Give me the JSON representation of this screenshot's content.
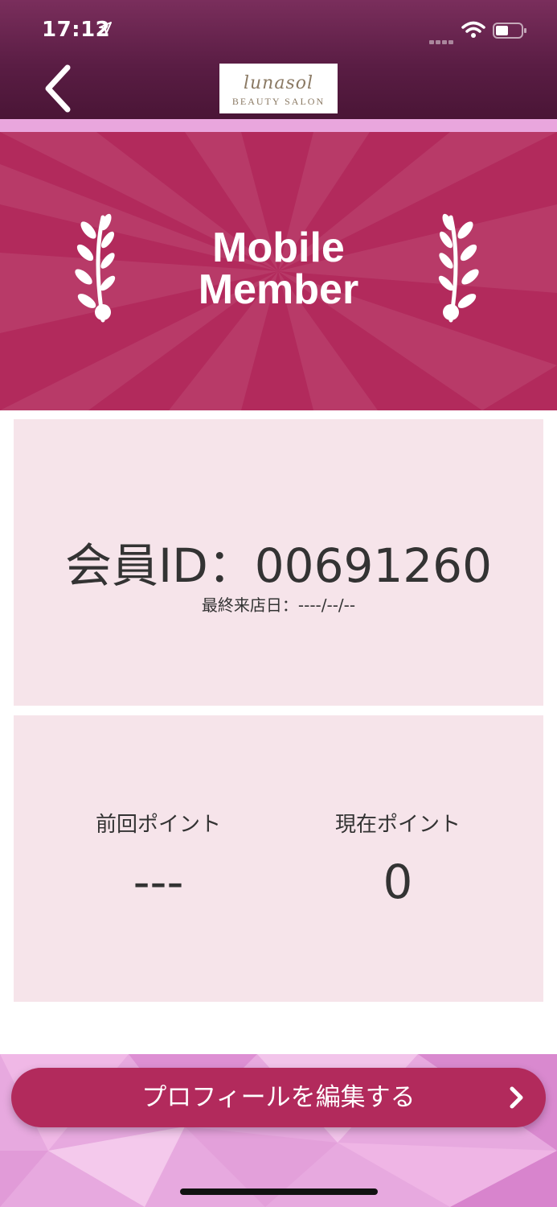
{
  "status_bar": {
    "time": "17:12"
  },
  "header": {
    "logo_script": "lunasol",
    "logo_sub": "BEAUTY SALON"
  },
  "banner": {
    "title_line1": "Mobile",
    "title_line2": "Member"
  },
  "member": {
    "id_text": "会員ID：00691260",
    "last_visit_text": "最終来店日：----/--/--"
  },
  "points": {
    "previous_label": "前回ポイント",
    "previous_value": "---",
    "current_label": "現在ポイント",
    "current_value": "0"
  },
  "footer": {
    "edit_profile_label": "プロフィールを編集する"
  },
  "colors": {
    "brand": "#b22a5c",
    "header": "#5a1d44",
    "card": "#f6e4ea",
    "footer_pink": "#e7a9df"
  }
}
